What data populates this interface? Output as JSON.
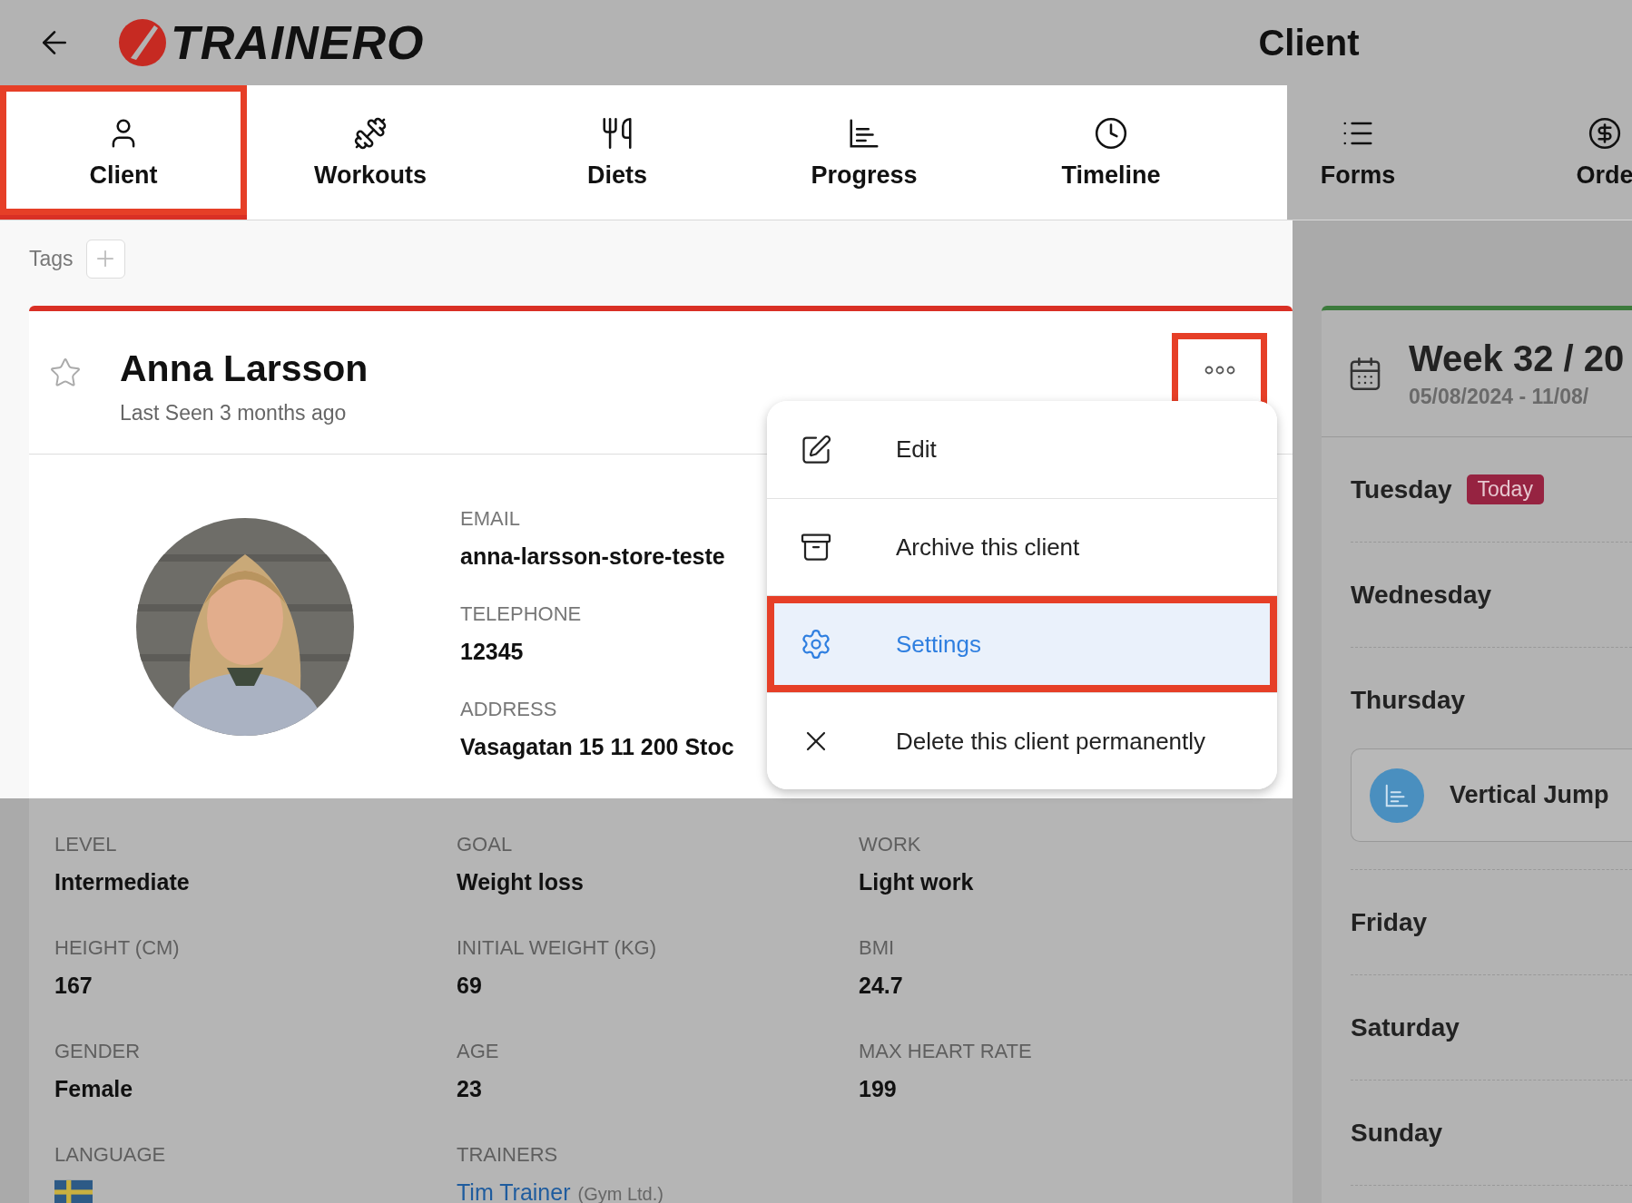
{
  "header": {
    "logo": "TRAINERO",
    "title": "Client"
  },
  "tabs": [
    {
      "label": "Client",
      "selected": true,
      "highlighted": true
    },
    {
      "label": "Workouts",
      "selected": false,
      "highlighted": false
    },
    {
      "label": "Diets",
      "selected": false,
      "highlighted": false
    },
    {
      "label": "Progress",
      "selected": false,
      "highlighted": false
    },
    {
      "label": "Timeline",
      "selected": false,
      "highlighted": false
    },
    {
      "label": "Forms",
      "selected": false,
      "highlighted": false
    },
    {
      "label": "Orde",
      "selected": false,
      "highlighted": false
    }
  ],
  "tags": {
    "label": "Tags"
  },
  "client": {
    "name": "Anna Larsson",
    "last_seen": "Last Seen 3 months ago",
    "starred": false,
    "more_button": {
      "highlighted": true
    },
    "contact": [
      {
        "label": "EMAIL",
        "value": "anna-larsson-store-teste"
      },
      {
        "label": "TELEPHONE",
        "value": "12345"
      },
      {
        "label": "ADDRESS",
        "value": "Vasagatan 15 11 200 Stoc"
      }
    ],
    "details": [
      {
        "kind": "text",
        "label": "LEVEL",
        "value": "Intermediate"
      },
      {
        "kind": "text",
        "label": "GOAL",
        "value": "Weight loss"
      },
      {
        "kind": "text",
        "label": "WORK",
        "value": "Light work"
      },
      {
        "kind": "text",
        "label": "HEIGHT (CM)",
        "value": "167"
      },
      {
        "kind": "text",
        "label": "INITIAL WEIGHT (KG)",
        "value": "69"
      },
      {
        "kind": "text",
        "label": "BMI",
        "value": "24.7"
      },
      {
        "kind": "text",
        "label": "GENDER",
        "value": "Female"
      },
      {
        "kind": "text",
        "label": "AGE",
        "value": "23"
      },
      {
        "kind": "text",
        "label": "MAX HEART RATE",
        "value": "199"
      },
      {
        "kind": "flag",
        "label": "LANGUAGE"
      },
      {
        "kind": "trainer",
        "label": "TRAINERS",
        "name": "Tim Trainer",
        "note": "(Gym Ltd.)"
      }
    ]
  },
  "menu": [
    {
      "label": "Edit",
      "selected": false,
      "highlighted": false
    },
    {
      "label": "Archive this client",
      "selected": false,
      "highlighted": false
    },
    {
      "label": "Settings",
      "selected": true,
      "highlighted": true
    },
    {
      "label": "Delete this client permanently",
      "selected": false,
      "highlighted": false
    }
  ],
  "week": {
    "title": "Week 32 / 20",
    "range": "05/08/2024 - 11/08/",
    "days": [
      {
        "name": "Tuesday",
        "badge": "Today"
      },
      {
        "name": "Wednesday"
      },
      {
        "name": "Thursday",
        "events": [
          {
            "title": "Vertical Jump"
          }
        ]
      },
      {
        "name": "Friday"
      },
      {
        "name": "Saturday"
      },
      {
        "name": "Sunday"
      }
    ]
  }
}
